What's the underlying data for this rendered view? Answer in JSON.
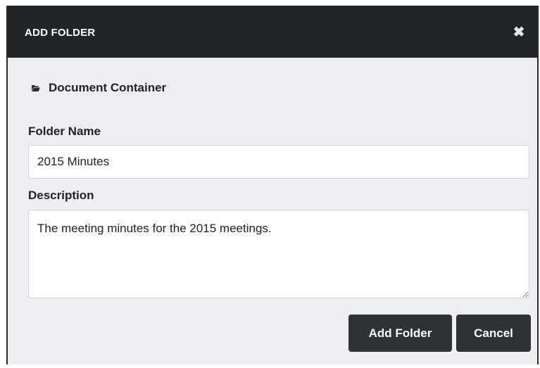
{
  "dialog": {
    "title": "ADD FOLDER",
    "close_glyph": "✖",
    "breadcrumb": {
      "icon": "folder-open-icon",
      "label": "Document Container"
    },
    "folder_name": {
      "label": "Folder Name",
      "value": "2015 Minutes"
    },
    "description": {
      "label": "Description",
      "value": "The meeting minutes for the 2015 meetings."
    },
    "buttons": {
      "add_label": "Add Folder",
      "cancel_label": "Cancel"
    }
  },
  "colors": {
    "header_bg": "#1f2428",
    "body_bg": "#eceef1",
    "button_bg": "#2e3338",
    "text": "#222222"
  }
}
